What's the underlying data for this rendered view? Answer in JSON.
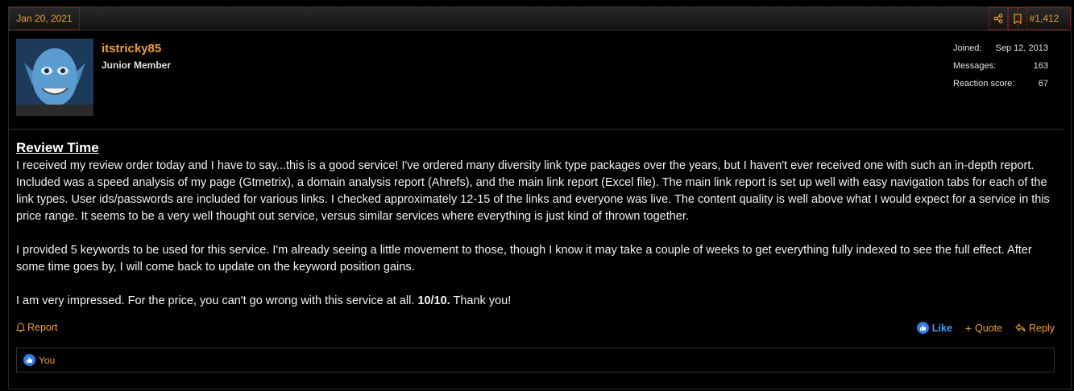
{
  "post": {
    "date": "Jan 20, 2021",
    "number": "#1,412"
  },
  "icons": {
    "share": "share-icon",
    "bookmark": "bookmark-icon",
    "report": "bell-icon",
    "like": "thumbs-up-icon",
    "quote": "plus-icon",
    "reply": "reply-icon"
  },
  "user": {
    "name": "itstricky85",
    "title": "Junior Member",
    "stats": [
      {
        "label": "Joined:",
        "value": "Sep 12, 2013"
      },
      {
        "label": "Messages:",
        "value": "163"
      },
      {
        "label": "Reaction score:",
        "value": "67"
      }
    ]
  },
  "content": {
    "headline": "Review Time",
    "paragraph1": "I received my review order today and I have to say...this is a good service! I've ordered many diversity link type packages over the years, but I haven't ever received one with such an in-depth report. Included was a speed analysis of my page (Gtmetrix), a domain analysis report (Ahrefs), and the main link report (Excel file). The main link report is set up well with easy navigation tabs for each of the link types. User ids/passwords are included for various links. I checked approximately 12-15 of the links and everyone was live. The content quality is well above what I would expect for a service in this price range. It seems to be a very well thought out service, versus similar services where everything is just kind of thrown together.",
    "paragraph2": "I provided 5 keywords to be used for this service. I'm already seeing a little movement to those, though I know it may take a couple of weeks to get everything fully indexed to see the full effect. After some time goes by, I will come back to update on the keyword position gains.",
    "paragraph3_pre": "I am very impressed. For the price, you can't go wrong with this service at all. ",
    "paragraph3_bold": "10/10.",
    "paragraph3_post": " Thank you!"
  },
  "actions": {
    "report": "Report",
    "like": "Like",
    "quote": "Quote",
    "reply": "Reply"
  },
  "reactions": {
    "who": "You"
  },
  "colors": {
    "accent": "#f0a020",
    "like": "#3fa0ff",
    "background": "#000000"
  }
}
